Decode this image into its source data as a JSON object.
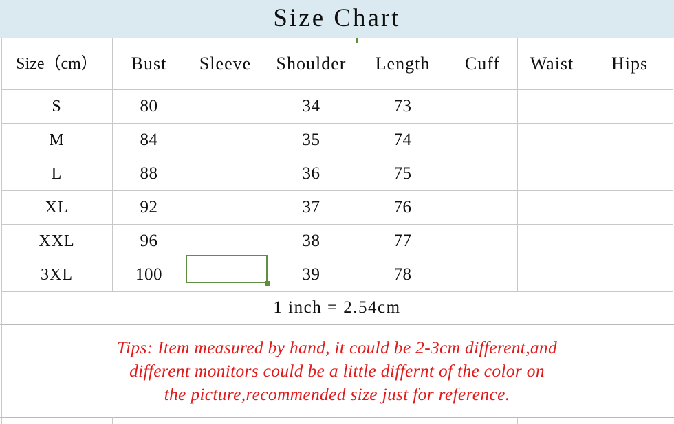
{
  "title": "Size Chart",
  "table": {
    "headers": [
      "Size（cm）",
      "Bust",
      "Sleeve",
      "Shoulder",
      "Length",
      "Cuff",
      "Waist",
      "Hips"
    ],
    "rows": [
      {
        "size": "S",
        "bust": "80",
        "sleeve": "",
        "shoulder": "34",
        "length": "73",
        "cuff": "",
        "waist": "",
        "hips": ""
      },
      {
        "size": "M",
        "bust": "84",
        "sleeve": "",
        "shoulder": "35",
        "length": "74",
        "cuff": "",
        "waist": "",
        "hips": ""
      },
      {
        "size": "L",
        "bust": "88",
        "sleeve": "",
        "shoulder": "36",
        "length": "75",
        "cuff": "",
        "waist": "",
        "hips": ""
      },
      {
        "size": "XL",
        "bust": "92",
        "sleeve": "",
        "shoulder": "37",
        "length": "76",
        "cuff": "",
        "waist": "",
        "hips": ""
      },
      {
        "size": "XXL",
        "bust": "96",
        "sleeve": "",
        "shoulder": "38",
        "length": "77",
        "cuff": "",
        "waist": "",
        "hips": ""
      },
      {
        "size": "3XL",
        "bust": "100",
        "sleeve": "",
        "shoulder": "39",
        "length": "78",
        "cuff": "",
        "waist": "",
        "hips": ""
      }
    ]
  },
  "conversion_note": "1 inch = 2.54cm",
  "tips": {
    "line1": "Tips: Item measured by hand,  it could be 2-3cm different,and",
    "line2": "different monitors could be a little differnt of the color on",
    "line3": "the picture,recommended size just for reference."
  },
  "selection": {
    "cell_row": "3XL",
    "cell_column": "Sleeve"
  },
  "colors": {
    "title_band": "#dbeaf0",
    "grid": "#c8c8c8",
    "text": "#101010",
    "tips_text": "#e01b1b",
    "selection_border": "#5f8f3e"
  }
}
